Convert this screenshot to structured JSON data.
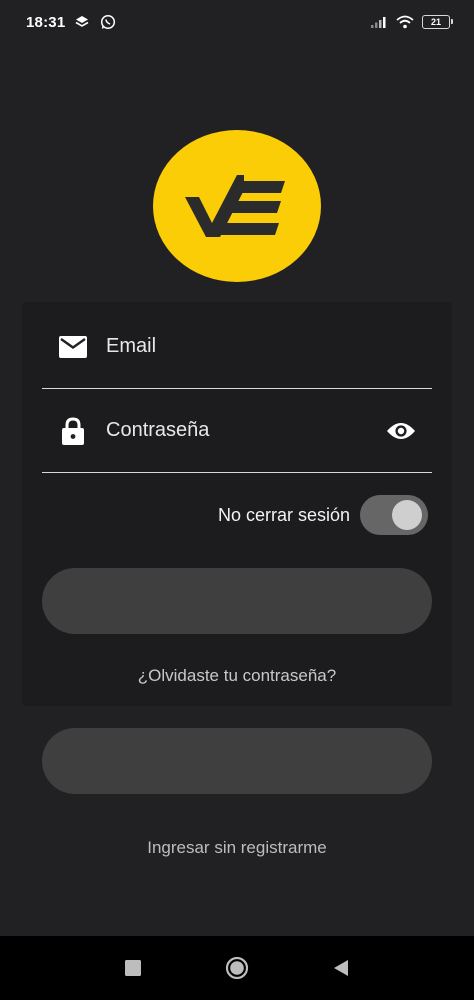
{
  "status_bar": {
    "time": "18:31",
    "icons_left": [
      "layers-icon",
      "whatsapp-icon"
    ],
    "icons_right": [
      "signal-icon",
      "wifi-icon",
      "battery-icon"
    ],
    "battery": "21"
  },
  "logo": {
    "icon": "check-e-logo-icon",
    "color": "#fbcd07"
  },
  "login_form": {
    "email_placeholder": "Email",
    "password_placeholder": "Contraseña",
    "remember_label": "No cerrar sesión",
    "remember_on": true,
    "login_button_label": "",
    "forgot_password": "¿Olvidaste tu contraseña?"
  },
  "register_button_label": "",
  "guest_link": "Ingresar sin registrarme",
  "nav_bar": {
    "icons": [
      "recent-apps-icon",
      "home-icon",
      "back-icon"
    ]
  },
  "colors": {
    "background": "#212023",
    "card": "#1c1c1e",
    "button": "#3f3f3f",
    "accent": "#fbcd07"
  }
}
